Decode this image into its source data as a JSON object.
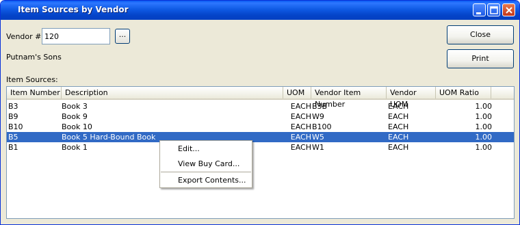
{
  "window": {
    "title": "Item Sources by Vendor"
  },
  "vendor": {
    "label": "Vendor #:",
    "value": "120",
    "lookup_label": "...",
    "name": "Putnam's Sons"
  },
  "buttons": {
    "close": "Close",
    "print": "Print"
  },
  "sources_label": "Item Sources:",
  "table": {
    "columns": [
      "Item Number",
      "Description",
      "UOM",
      "Vendor Item Number",
      "Vendor UOM",
      "UOM Ratio"
    ],
    "rows": [
      [
        "B3",
        "Book 3",
        "EACH",
        "B3B",
        "EACH",
        "1.00"
      ],
      [
        "B9",
        "Book 9",
        "EACH",
        "W9",
        "EACH",
        "1.00"
      ],
      [
        "B10",
        "Book 10",
        "EACH",
        "B100",
        "EACH",
        "1.00"
      ],
      [
        "B5",
        "Book 5 Hard-Bound Book",
        "EACH",
        "W5",
        "EACH",
        "1.00"
      ],
      [
        "B1",
        "Book 1",
        "EACH",
        "W1",
        "EACH",
        "1.00"
      ]
    ],
    "selected_row": 3
  },
  "context_menu": {
    "items": [
      "Edit...",
      "View Buy Card...",
      "Export Contents..."
    ]
  },
  "colors": {
    "title_bar": "#0a5bf3",
    "selection": "#316ac5",
    "window_bg": "#ece9d8"
  }
}
